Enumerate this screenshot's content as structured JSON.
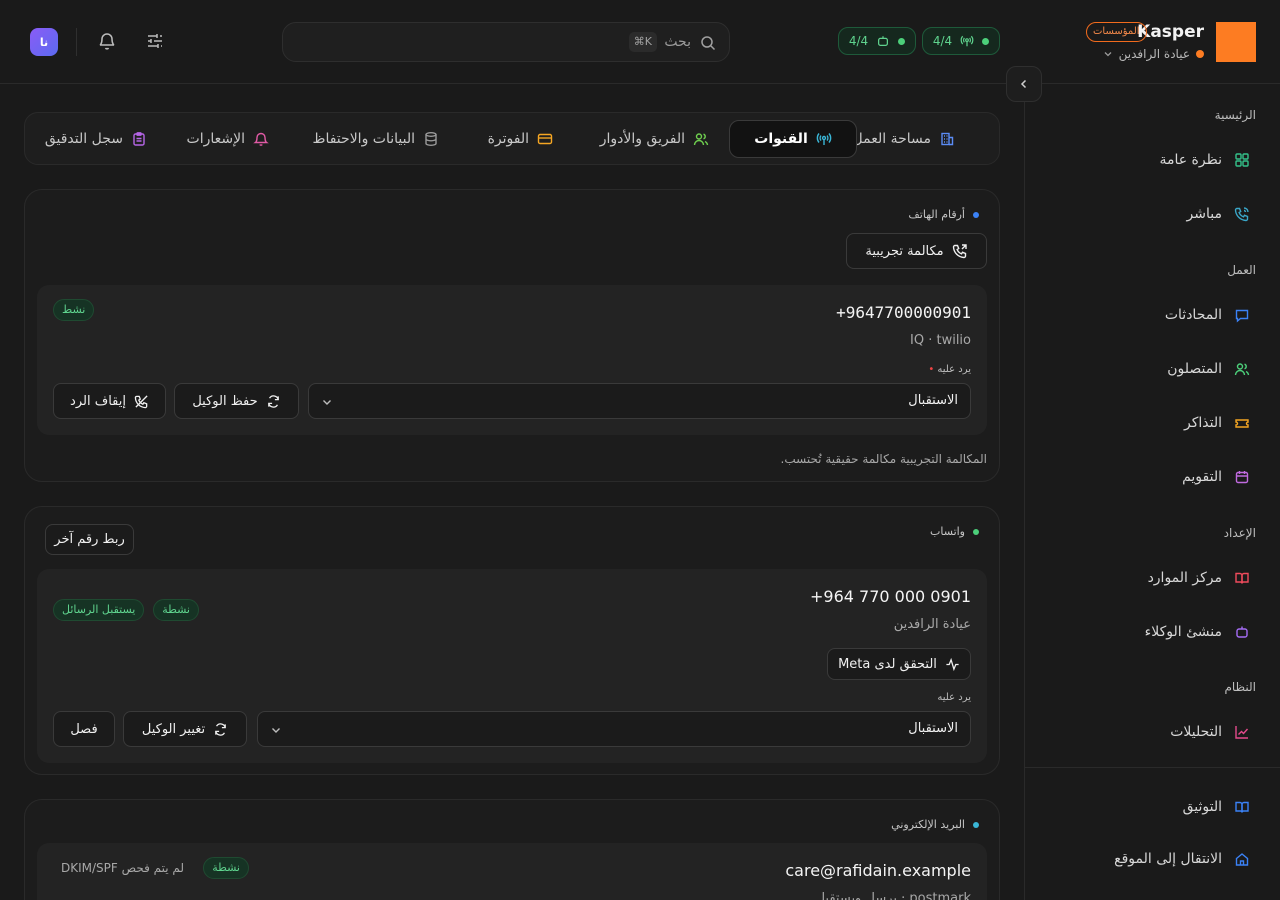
{
  "header": {
    "brand_name": "Kasper",
    "brand_badge": "المؤسسات",
    "org_name": "عيادة الرافدين",
    "pill_channels": "4/4",
    "pill_agents": "4/4",
    "search_placeholder": "بحث",
    "search_shortcut": "⌘K",
    "avatar_initials": "نا"
  },
  "sidebar": {
    "sections": [
      {
        "label": "الرئيسية",
        "items": [
          {
            "label": "نظرة عامة",
            "icon": "grid-icon"
          },
          {
            "label": "مباشر",
            "icon": "phone-call-icon"
          }
        ]
      },
      {
        "label": "العمل",
        "items": [
          {
            "label": "المحادثات",
            "icon": "message-icon"
          },
          {
            "label": "المتصلون",
            "icon": "users-icon"
          },
          {
            "label": "التذاكر",
            "icon": "ticket-icon"
          },
          {
            "label": "التقويم",
            "icon": "calendar-icon"
          }
        ]
      },
      {
        "label": "الإعداد",
        "items": [
          {
            "label": "مركز الموارد",
            "icon": "book-icon"
          },
          {
            "label": "منشئ الوكلاء",
            "icon": "bot-icon"
          }
        ]
      },
      {
        "label": "النظام",
        "items": [
          {
            "label": "التحليلات",
            "icon": "chart-icon"
          }
        ]
      }
    ],
    "footer": [
      {
        "label": "التوثيق",
        "icon": "book-icon"
      },
      {
        "label": "الانتقال إلى الموقع",
        "icon": "home-icon"
      }
    ]
  },
  "tabs": [
    {
      "label": "مساحة العمل",
      "icon": "building-icon"
    },
    {
      "label": "القنوات",
      "icon": "antenna-icon",
      "active": true
    },
    {
      "label": "الفريق والأدوار",
      "icon": "users-icon"
    },
    {
      "label": "الفوترة",
      "icon": "credit-card-icon"
    },
    {
      "label": "البيانات والاحتفاظ",
      "icon": "database-icon"
    },
    {
      "label": "الإشعارات",
      "icon": "bell-icon"
    },
    {
      "label": "سجل التدقيق",
      "icon": "clipboard-icon"
    }
  ],
  "phone_card": {
    "title": "أرقام الهاتف",
    "test_call": "مكالمة تجريبية",
    "number": "+9647700000901",
    "meta": "IQ · twilio",
    "status": "نشط",
    "answered_by_label": "يرد عليه",
    "agent_value": "الاستقبال",
    "save_agent": "حفظ الوكيل",
    "stop_answer": "إيقاف الرد",
    "note": "المكالمة التجريبية مكالمة حقيقية تُحتسب."
  },
  "whatsapp_card": {
    "title": "واتساب",
    "link_another": "ربط رقم آخر",
    "number": "+964 770 000 0901",
    "org": "عيادة الرافدين",
    "status": "نشطة",
    "receives": "يستقبل الرسائل",
    "verify_meta": "التحقق لدى Meta",
    "answered_by_label": "يرد عليه",
    "agent_value": "الاستقبال",
    "change_agent": "تغيير الوكيل",
    "disconnect": "فصل"
  },
  "email_card": {
    "title": "البريد الإلكتروني",
    "address": "care@rafidain.example",
    "status": "نشطة",
    "dkim": "لم يتم فحص DKIM/SPF",
    "meta": "postmark · يرسل ويستقبل"
  },
  "colors": {
    "brand": "#fd7c22",
    "active_green": "#5fd38e",
    "accent_blue": "#3b82f6"
  }
}
